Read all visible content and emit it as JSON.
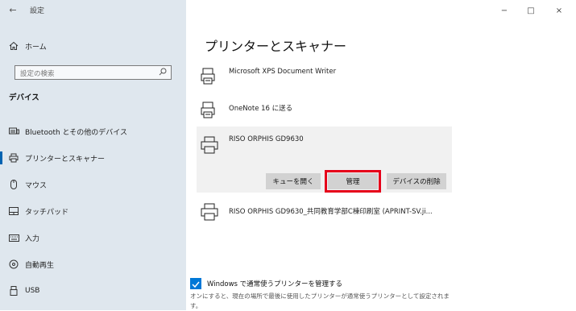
{
  "window": {
    "title": "設定",
    "back_glyph": "←",
    "controls": {
      "minimize": "−",
      "maximize": "□",
      "close": "×"
    }
  },
  "sidebar": {
    "home_label": "ホーム",
    "search_placeholder": "設定の検索",
    "section_title": "デバイス",
    "items": [
      {
        "label": "Bluetooth とその他のデバイス",
        "icon": "keyboard-icon"
      },
      {
        "label": "プリンターとスキャナー",
        "icon": "printer-icon",
        "active": true
      },
      {
        "label": "マウス",
        "icon": "mouse-icon"
      },
      {
        "label": "タッチパッド",
        "icon": "touchpad-icon"
      },
      {
        "label": "入力",
        "icon": "keyboard-icon"
      },
      {
        "label": "自動再生",
        "icon": "autoplay-icon"
      },
      {
        "label": "USB",
        "icon": "usb-icon"
      }
    ]
  },
  "main": {
    "title": "プリンターとスキャナー",
    "printers": [
      {
        "name": "Microsoft XPS Document Writer",
        "icon": "document-printer-icon"
      },
      {
        "name": "OneNote 16 に送る",
        "icon": "document-printer-icon"
      },
      {
        "name": "RISO ORPHIS GD9630",
        "icon": "printer-icon",
        "selected": true
      },
      {
        "name": "RISO ORPHIS GD9630_共同教育学部C棟印刷室 (APRINT-SV.ji...",
        "icon": "printer-icon"
      }
    ],
    "actions": {
      "open_queue": "キューを開く",
      "manage": "管理",
      "remove_device": "デバイスの削除"
    },
    "default_printer": {
      "checked": true,
      "label": "Windows で通常使うプリンターを管理する",
      "description": "オンにすると、現在の場所で最後に使用したプリンターが通常使うプリンターとして設定されます。"
    }
  },
  "colors": {
    "accent": "#0078d7",
    "highlight": "#e6001a",
    "sidebar_bg": "#dfe7ee"
  }
}
